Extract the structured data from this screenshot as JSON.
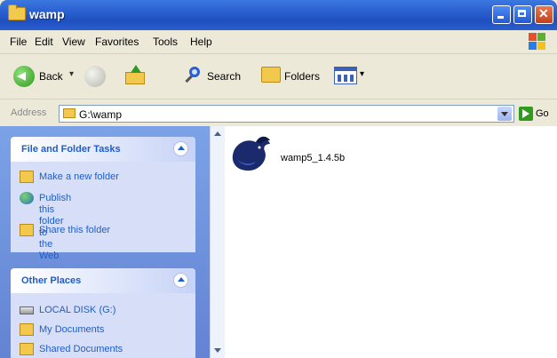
{
  "window": {
    "title": "wamp"
  },
  "menu": [
    {
      "label": "File"
    },
    {
      "label": "Edit"
    },
    {
      "label": "View"
    },
    {
      "label": "Favorites"
    },
    {
      "label": "Tools"
    },
    {
      "label": "Help"
    }
  ],
  "toolbar": {
    "back_label": "Back",
    "search_label": "Search",
    "folders_label": "Folders"
  },
  "address": {
    "label": "Address",
    "value": "G:\\wamp",
    "go_label": "Go"
  },
  "tasks": {
    "title": "File and Folder Tasks",
    "items": [
      {
        "label": "Make a new folder",
        "icon": "new-folder-icon"
      },
      {
        "label": "Publish this folder to\nthe Web",
        "icon": "globe-icon"
      },
      {
        "label": "Share this folder",
        "icon": "share-folder-icon"
      }
    ]
  },
  "places": {
    "title": "Other Places",
    "items": [
      {
        "label": "LOCAL DISK (G:)",
        "icon": "drive-icon"
      },
      {
        "label": "My Documents",
        "icon": "documents-icon"
      },
      {
        "label": "Shared Documents",
        "icon": "shared-documents-icon"
      }
    ]
  },
  "files": [
    {
      "name": "wamp5_1.4.5b",
      "icon": "wampserver-installer-icon"
    }
  ],
  "colors": {
    "titlebar": "#2a5fd0",
    "taskpane": "#7ba2e7",
    "link": "#215dc6"
  }
}
